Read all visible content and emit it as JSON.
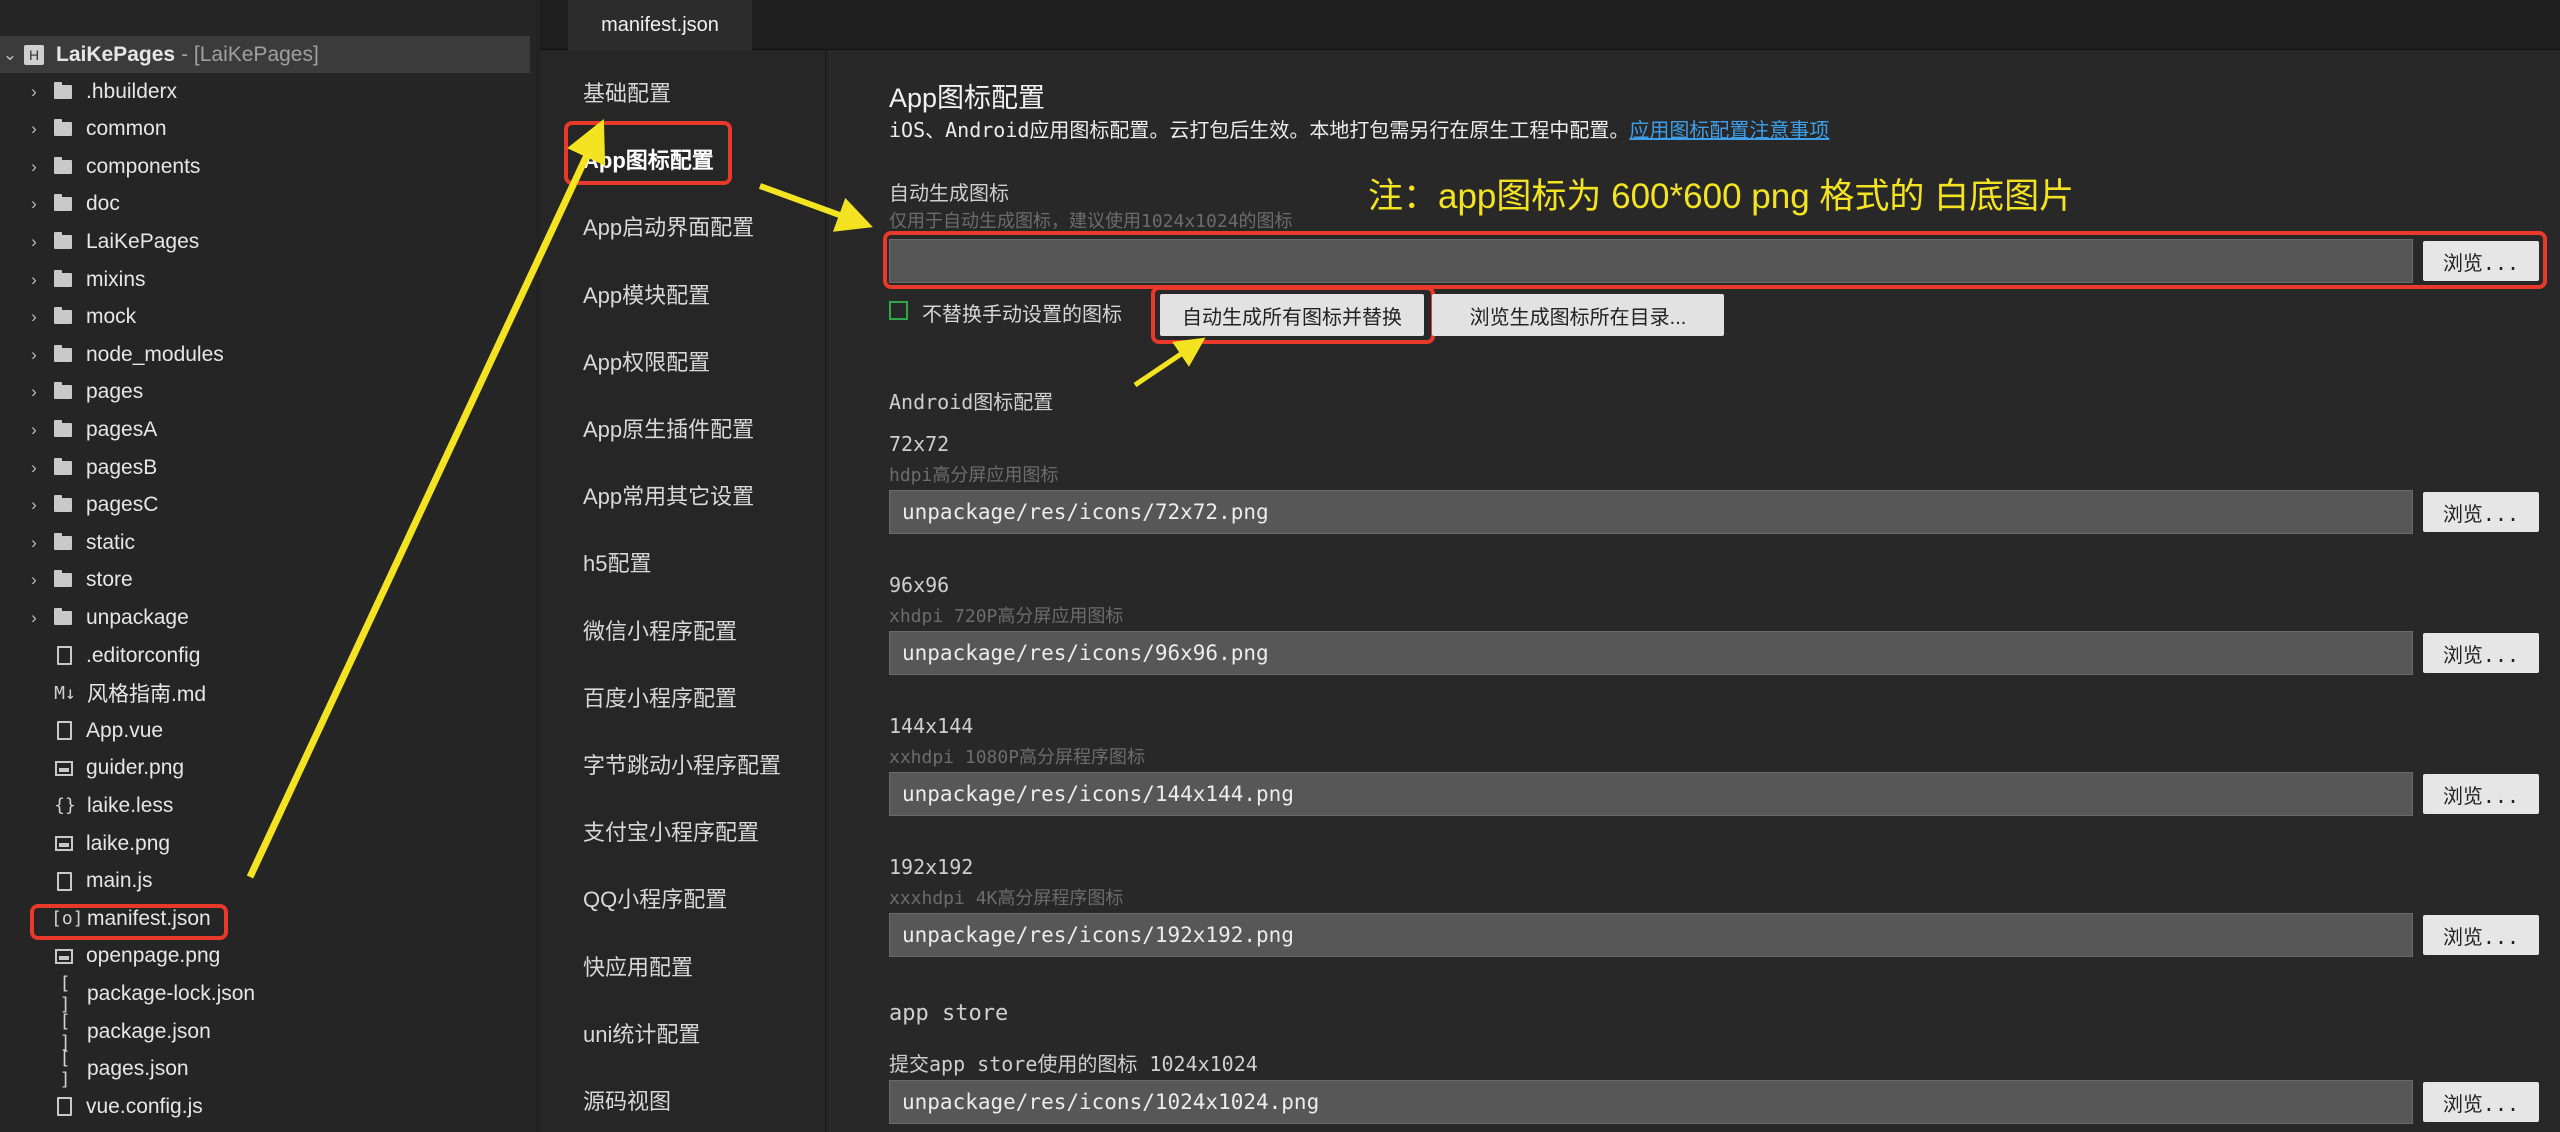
{
  "file_tree": {
    "root": {
      "name": "LaiKePages",
      "suffix": "- [LaiKePages]"
    },
    "items": [
      {
        "name": ".hbuilderx",
        "kind": "folder"
      },
      {
        "name": "common",
        "kind": "folder"
      },
      {
        "name": "components",
        "kind": "folder"
      },
      {
        "name": "doc",
        "kind": "folder"
      },
      {
        "name": "LaiKePages",
        "kind": "folder"
      },
      {
        "name": "mixins",
        "kind": "folder"
      },
      {
        "name": "mock",
        "kind": "folder"
      },
      {
        "name": "node_modules",
        "kind": "folder"
      },
      {
        "name": "pages",
        "kind": "folder"
      },
      {
        "name": "pagesA",
        "kind": "folder"
      },
      {
        "name": "pagesB",
        "kind": "folder"
      },
      {
        "name": "pagesC",
        "kind": "folder"
      },
      {
        "name": "static",
        "kind": "folder"
      },
      {
        "name": "store",
        "kind": "folder"
      },
      {
        "name": "unpackage",
        "kind": "folder"
      },
      {
        "name": ".editorconfig",
        "kind": "file"
      },
      {
        "name": "风格指南.md",
        "kind": "md",
        "glyph": "M↓"
      },
      {
        "name": "App.vue",
        "kind": "file"
      },
      {
        "name": "guider.png",
        "kind": "image"
      },
      {
        "name": "laike.less",
        "kind": "code",
        "glyph": "{}"
      },
      {
        "name": "laike.png",
        "kind": "image"
      },
      {
        "name": "main.js",
        "kind": "file"
      },
      {
        "name": "manifest.json",
        "kind": "code",
        "glyph": "[o]"
      },
      {
        "name": "openpage.png",
        "kind": "image"
      },
      {
        "name": "package-lock.json",
        "kind": "code",
        "glyph": "[ ]"
      },
      {
        "name": "package.json",
        "kind": "code",
        "glyph": "[ ]"
      },
      {
        "name": "pages.json",
        "kind": "code",
        "glyph": "[ ]"
      },
      {
        "name": "vue.config.js",
        "kind": "file"
      }
    ]
  },
  "tab": {
    "label": "manifest.json"
  },
  "config_nav": {
    "items": [
      "基础配置",
      "App图标配置",
      "App启动界面配置",
      "App模块配置",
      "App权限配置",
      "App原生插件配置",
      "App常用其它设置",
      "h5配置",
      "微信小程序配置",
      "百度小程序配置",
      "字节跳动小程序配置",
      "支付宝小程序配置",
      "QQ小程序配置",
      "快应用配置",
      "uni统计配置",
      "源码视图"
    ],
    "active_index": 1
  },
  "main": {
    "title": "App图标配置",
    "desc": "iOS、Android应用图标配置。云打包后生效。本地打包需另行在原生工程中配置。",
    "desc_link": "应用图标配置注意事项",
    "auto": {
      "label": "自动生成图标",
      "sub": "仅用于自动生成图标，建议使用1024x1024的图标",
      "value": "",
      "checkbox_label": "不替换手动设置的图标",
      "gen_button": "自动生成所有图标并替换",
      "open_dir_button": "浏览生成图标所在目录..."
    },
    "browse_label": "浏览...",
    "android_heading": "Android图标配置",
    "android_icons": [
      {
        "size": "72x72",
        "desc": "hdpi高分屏应用图标",
        "path": "unpackage/res/icons/72x72.png"
      },
      {
        "size": "96x96",
        "desc": "xhdpi 720P高分屏应用图标",
        "path": "unpackage/res/icons/96x96.png"
      },
      {
        "size": "144x144",
        "desc": "xxhdpi 1080P高分屏程序图标",
        "path": "unpackage/res/icons/144x144.png"
      },
      {
        "size": "192x192",
        "desc": "xxxhdpi 4K高分屏程序图标",
        "path": "unpackage/res/icons/192x192.png"
      }
    ],
    "appstore_heading": "app store",
    "appstore": {
      "label": "提交app store使用的图标 1024x1024",
      "path": "unpackage/res/icons/1024x1024.png"
    }
  },
  "annotation": {
    "note": "注：app图标为 600*600 png 格式的 白底图片",
    "highlight_color": "#e8392a",
    "arrow_color": "#f4e321"
  }
}
